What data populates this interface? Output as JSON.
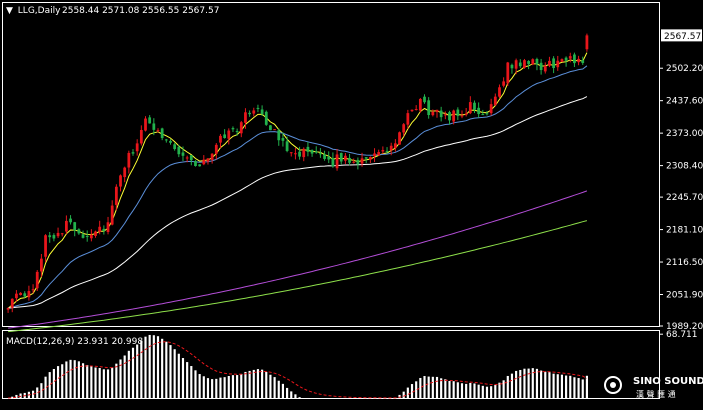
{
  "header": {
    "symbol": "LLG,Daily",
    "ohlc": "2558.44 2571.08 2556.55 2567.57"
  },
  "macd_header": "MACD(12,26,9) 23.931 20.998",
  "logo": {
    "main": "SINO SOUND",
    "sub": "漢 聲 匯 通"
  },
  "colors": {
    "background": "#000000",
    "grid": "#ffffff",
    "bull": "#22b14c",
    "bear": "#e8161b",
    "ma5": "#ffff33",
    "ma20": "#5b8fd9",
    "ma60": "#ffffff",
    "ma120": "#b44ed8",
    "ma200": "#8ee04b",
    "macd_hist": "#ffffff",
    "macd_signal": "#e8161b",
    "price_box": "#ffffff"
  },
  "chart_data": [
    {
      "type": "candlestick",
      "ylim": [
        1989.2,
        2632.0
      ],
      "yticks": [
        {
          "value": 2502.2,
          "label": "2502.20"
        },
        {
          "value": 2437.6,
          "label": "2437.60"
        },
        {
          "value": 2373.0,
          "label": "2373.00"
        },
        {
          "value": 2308.4,
          "label": "2308.40"
        },
        {
          "value": 2245.7,
          "label": "2245.70"
        },
        {
          "value": 2181.1,
          "label": "2181.10"
        },
        {
          "value": 2116.5,
          "label": "2116.50"
        },
        {
          "value": 2051.9,
          "label": "2051.90"
        },
        {
          "value": 1989.2,
          "label": "1989.20"
        }
      ],
      "last_price": {
        "value": 2567.57,
        "label": "2567.57"
      },
      "anchors": [
        2035,
        2048,
        2055,
        2170,
        2175,
        2195,
        2170,
        2180,
        2190,
        2290,
        2340,
        2392,
        2382,
        2352,
        2330,
        2310,
        2318,
        2370,
        2375,
        2405,
        2430,
        2380,
        2352,
        2338,
        2330,
        2322,
        2318,
        2323,
        2318,
        2332,
        2330,
        2355,
        2402,
        2438,
        2408,
        2410,
        2408,
        2425,
        2406,
        2450,
        2505,
        2515,
        2510,
        2505,
        2515,
        2518,
        2520
      ],
      "last_candle": {
        "open": 2540,
        "high": 2571.08,
        "low": 2535,
        "close": 2567.57
      },
      "moving_averages": [
        {
          "key": "ma5",
          "smoothing": "ema",
          "period": 5
        },
        {
          "key": "ma20",
          "smoothing": "ema",
          "period": 20
        },
        {
          "key": "ma60",
          "smoothing": "ema",
          "period": 60
        },
        {
          "key": "ma120",
          "smoothing": "sma",
          "period": 120,
          "start": 1985,
          "end": 2258
        },
        {
          "key": "ma200",
          "smoothing": "sma",
          "period": 200,
          "start": 1978,
          "end": 2199
        }
      ]
    },
    {
      "type": "histogram",
      "name": "MACD(12,26,9)",
      "ylim": [
        0,
        70
      ],
      "yticks": [
        {
          "value": 68.711,
          "label": "68.711"
        }
      ],
      "macd": 23.931,
      "signal": 20.998
    }
  ]
}
